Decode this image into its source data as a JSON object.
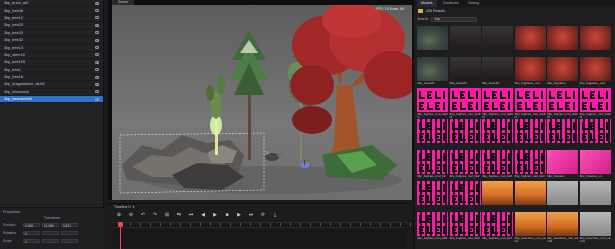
{
  "outliner": {
    "items": [
      {
        "label": "3kp_truck_wt2",
        "selected": false
      },
      {
        "label": "3kp_tree08",
        "selected": false
      },
      {
        "label": "3kp_tree12",
        "selected": false
      },
      {
        "label": "3kp_tree20",
        "selected": false
      },
      {
        "label": "3kp_tree25",
        "selected": false
      },
      {
        "label": "3kp_tree32",
        "selected": false
      },
      {
        "label": "3kp_tree13",
        "selected": false
      },
      {
        "label": "3kp_stem15",
        "selected": false
      },
      {
        "label": "3kp_tree105",
        "selected": false
      },
      {
        "label": "3kp_tree1",
        "selected": false
      },
      {
        "label": "3kp_tree16",
        "selected": false
      },
      {
        "label": "3kp_dragonstone_alu92",
        "selected": false
      },
      {
        "label": "3kp_beamrock",
        "selected": false
      },
      {
        "label": "3kp_beamsmr09",
        "selected": true
      }
    ]
  },
  "properties": {
    "title": "Properties",
    "section": "Transform",
    "rows": [
      {
        "label": "Position",
        "x": "0.156",
        "y": "11.096",
        "z": "0.871"
      },
      {
        "label": "Rotation",
        "x": "0",
        "y": "",
        "z": ""
      },
      {
        "label": "Scale",
        "x": "1",
        "y": "",
        "z": ""
      }
    ]
  },
  "viewport": {
    "tab_label": "Scene",
    "fps": "FPS: 74   Draw: 96"
  },
  "timeline": {
    "title": "Timeline 0",
    "controls": [
      "⊕",
      "⊖",
      "↶",
      "↷",
      "⊞",
      "⇆",
      "⏮",
      "◀",
      "▶",
      "■",
      "▶",
      "⏭",
      "⟳",
      "⤓"
    ]
  },
  "assets": {
    "tabs": [
      {
        "label": "Models",
        "active": true
      },
      {
        "label": "Creatures",
        "active": false
      },
      {
        "label": "Debug",
        "active": false
      }
    ],
    "breadcrumb": "435 Results",
    "search_label": "Search",
    "search_value": "3kp",
    "items": [
      {
        "caption": "",
        "thumb": "th-scene"
      },
      {
        "caption": "",
        "thumb": "th-dark"
      },
      {
        "caption": "",
        "thumb": "th-dark"
      },
      {
        "caption": "",
        "thumb": "th-red"
      },
      {
        "caption": "",
        "thumb": "th-red"
      },
      {
        "caption": "",
        "thumb": "th-red"
      },
      {
        "caption": "3kp_tree120",
        "thumb": "th-scene"
      },
      {
        "caption": "3kp_tree121",
        "thumb": "th-dark"
      },
      {
        "caption": "3kp_tree122",
        "thumb": "th-dark"
      },
      {
        "caption": "3kp_fogplane_uv1",
        "thumb": "th-red"
      },
      {
        "caption": "3kp_fogplane",
        "thumb": "th-red"
      },
      {
        "caption": "3kp_fogplane_uv2",
        "thumb": "th-red"
      },
      {
        "caption": "3kp_foglnes_mul_leaftr1",
        "thumb": "th-mag"
      },
      {
        "caption": "3kp_foglnes_mul_leaftr2",
        "thumb": "th-mag"
      },
      {
        "caption": "3kp_foglnes_mul_leaftr3",
        "thumb": "th-mag"
      },
      {
        "caption": "3kp_foglnes_mul_leaftr4",
        "thumb": "th-mag"
      },
      {
        "caption": "3kp_foglnes_mul_leaftr5",
        "thumb": "th-mag"
      },
      {
        "caption": "3kp_foglnes_mul_leaftr6",
        "thumb": "th-mag"
      },
      {
        "caption": "",
        "thumb": "th-fallback"
      },
      {
        "caption": "",
        "thumb": "th-fallback"
      },
      {
        "caption": "",
        "thumb": "th-fallback"
      },
      {
        "caption": "",
        "thumb": "th-fallback"
      },
      {
        "caption": "",
        "thumb": "th-fallback"
      },
      {
        "caption": "",
        "thumb": "th-fallback"
      },
      {
        "caption": "3kp_foglnes_mul_bk",
        "thumb": "th-fallback"
      },
      {
        "caption": "3kp_foglnes_mul_bk2",
        "thumb": "th-fallback"
      },
      {
        "caption": "3kp_foglnes_mul_bk3",
        "thumb": "th-fallback"
      },
      {
        "caption": "3kp_foglnes_mul_bk4",
        "thumb": "th-fallback"
      },
      {
        "caption": "3kp_shadow",
        "thumb": "th-pink"
      },
      {
        "caption": "3kp_shadow_uv",
        "thumb": "th-pink"
      },
      {
        "caption": "",
        "thumb": "th-fallback"
      },
      {
        "caption": "",
        "thumb": "th-fallback"
      },
      {
        "caption": "",
        "thumb": "th-orange"
      },
      {
        "caption": "",
        "thumb": "th-orange"
      },
      {
        "caption": "",
        "thumb": "th-grey"
      },
      {
        "caption": "",
        "thumb": "th-grey"
      },
      {
        "caption": "3kp_foglnes_mul_bk5",
        "thumb": "th-fallback"
      },
      {
        "caption": "3kp_foglnes_mul_bk6",
        "thumb": "th-fallback"
      },
      {
        "caption": "3kp_foglnes_mul_bk7",
        "thumb": "th-fallback"
      },
      {
        "caption": "3kp_beachsm_mul_sand",
        "thumb": "th-orange"
      },
      {
        "caption": "3kp_beachsm_mul_sand2",
        "thumb": "th-orange"
      },
      {
        "caption": "3kp_beachsm_mul_sand3",
        "thumb": "th-grey"
      }
    ]
  }
}
